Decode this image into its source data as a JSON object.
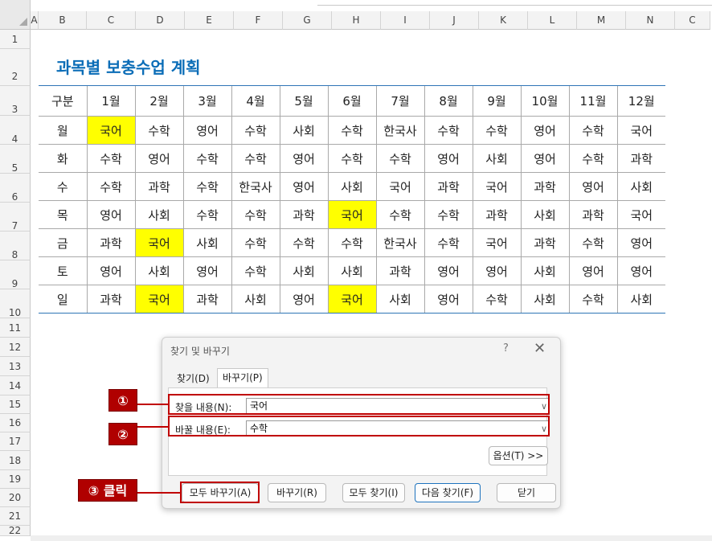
{
  "sheet": {
    "col_headers": [
      "A",
      "B",
      "C",
      "D",
      "E",
      "F",
      "G",
      "H",
      "I",
      "J",
      "K",
      "L",
      "M",
      "N",
      "C"
    ],
    "row_headers": [
      "1",
      "2",
      "3",
      "4",
      "5",
      "6",
      "7",
      "8",
      "9",
      "10",
      "11",
      "12",
      "13",
      "14",
      "15",
      "16",
      "17",
      "18",
      "19",
      "20",
      "21",
      "22"
    ]
  },
  "title": "과목별 보충수업 계획",
  "table": {
    "header": [
      "구분",
      "1월",
      "2월",
      "3월",
      "4월",
      "5월",
      "6월",
      "7월",
      "8월",
      "9월",
      "10월",
      "11월",
      "12월"
    ],
    "rows": [
      {
        "day": "월",
        "cells": [
          "국어",
          "수학",
          "영어",
          "수학",
          "사회",
          "수학",
          "한국사",
          "수학",
          "수학",
          "영어",
          "수학",
          "국어"
        ]
      },
      {
        "day": "화",
        "cells": [
          "수학",
          "영어",
          "수학",
          "수학",
          "영어",
          "수학",
          "수학",
          "영어",
          "사회",
          "영어",
          "수학",
          "과학"
        ]
      },
      {
        "day": "수",
        "cells": [
          "수학",
          "과학",
          "수학",
          "한국사",
          "영어",
          "사회",
          "국어",
          "과학",
          "국어",
          "과학",
          "영어",
          "사회"
        ]
      },
      {
        "day": "목",
        "cells": [
          "영어",
          "사회",
          "수학",
          "수학",
          "과학",
          "국어",
          "수학",
          "수학",
          "과학",
          "사회",
          "과학",
          "국어"
        ]
      },
      {
        "day": "금",
        "cells": [
          "과학",
          "국어",
          "사회",
          "수학",
          "수학",
          "수학",
          "한국사",
          "수학",
          "국어",
          "과학",
          "수학",
          "영어"
        ]
      },
      {
        "day": "토",
        "cells": [
          "영어",
          "사회",
          "영어",
          "수학",
          "사회",
          "사회",
          "과학",
          "영어",
          "영어",
          "사회",
          "영어",
          "영어"
        ]
      },
      {
        "day": "일",
        "cells": [
          "과학",
          "국어",
          "과학",
          "사회",
          "영어",
          "국어",
          "사회",
          "영어",
          "수학",
          "사회",
          "수학",
          "사회"
        ]
      }
    ],
    "highlight_color": "#ffff00"
  },
  "dialog": {
    "title": "찾기 및 바꾸기",
    "help": "?",
    "close": "✕",
    "tabs": [
      "찾기(D)",
      "바꾸기(P)"
    ],
    "find_label": "찾을 내용(N):",
    "find_value": "국어",
    "replace_label": "바꿀 내용(E):",
    "replace_value": "수학",
    "options_button": "옵션(T) >>",
    "buttons": {
      "replace_all": "모두 바꾸기(A)",
      "replace": "바꾸기(R)",
      "find_all": "모두 찾기(I)",
      "find_next": "다음 찾기(F)",
      "close": "닫기"
    }
  },
  "callouts": {
    "one": "①",
    "two": "②",
    "three": "③ 클릭"
  },
  "colors": {
    "accent": "#c00000",
    "title": "#0b6db7",
    "highlight": "#ffff00"
  }
}
